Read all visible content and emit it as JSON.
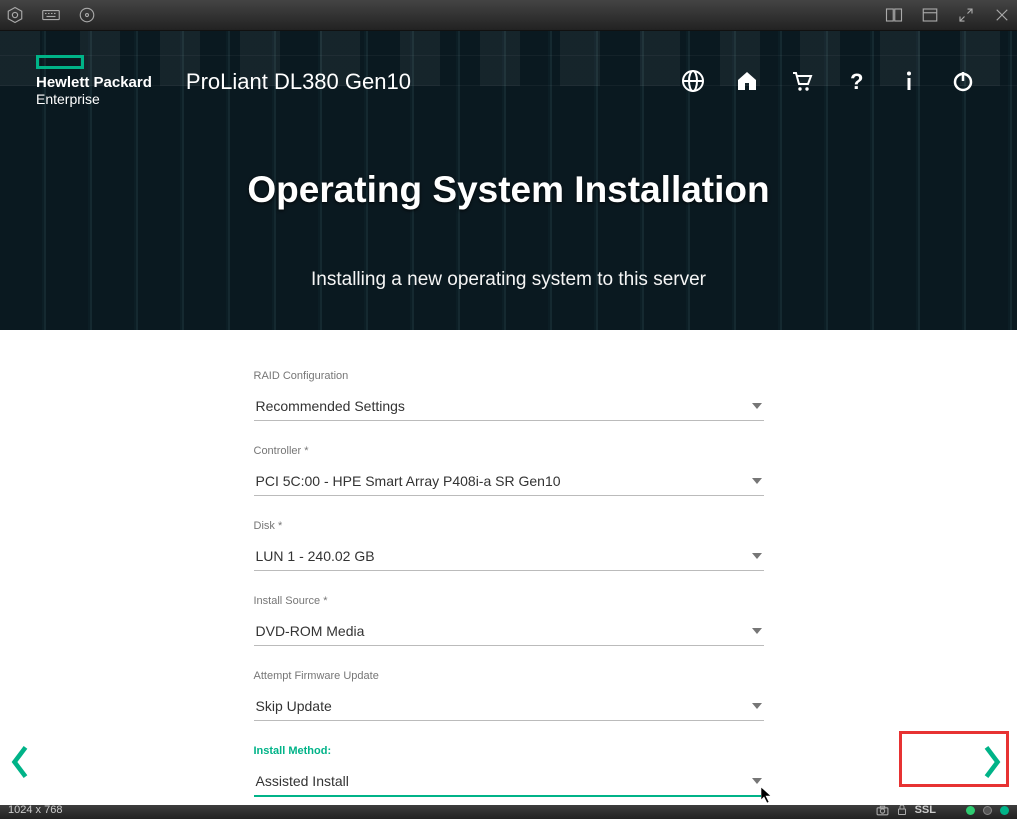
{
  "brand": {
    "line1": "Hewlett Packard",
    "line2": "Enterprise"
  },
  "product_name": "ProLiant DL380 Gen10",
  "banner": {
    "title": "Operating System Installation",
    "subtitle": "Installing a new operating system to this server"
  },
  "form": {
    "raid": {
      "label": "RAID Configuration",
      "value": "Recommended Settings"
    },
    "controller": {
      "label": "Controller *",
      "value": "PCI 5C:00 - HPE Smart Array P408i-a SR Gen10"
    },
    "disk": {
      "label": "Disk *",
      "value": "LUN 1 - 240.02 GB"
    },
    "source": {
      "label": "Install Source *",
      "value": "DVD-ROM Media"
    },
    "firmware": {
      "label": "Attempt Firmware Update",
      "value": "Skip Update"
    },
    "method": {
      "label": "Install Method:",
      "value": "Assisted Install"
    }
  },
  "statusbar": {
    "resolution": "1024 x 768",
    "ssl": "SSL"
  },
  "colors": {
    "accent": "#00b388",
    "highlight": "#e73232"
  }
}
